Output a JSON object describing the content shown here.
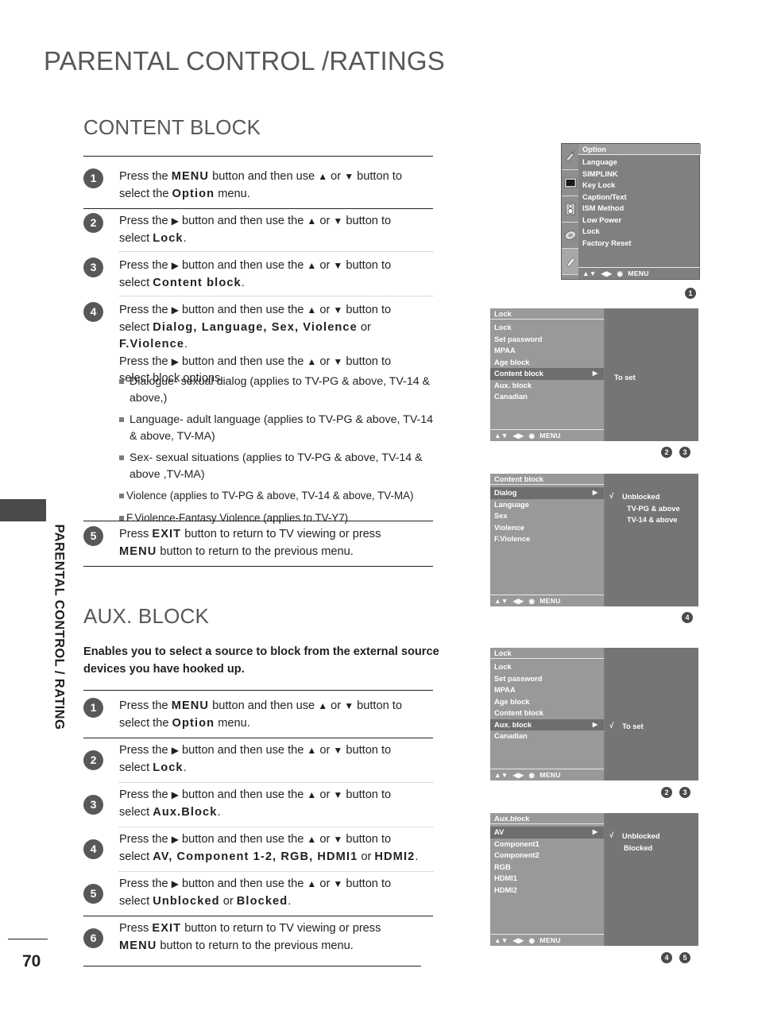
{
  "document": {
    "title": "PARENTAL CONTROL /RATINGS",
    "page_number": "70",
    "side_tab_label": "PARENTAL CONTROL / RATING"
  },
  "content_block": {
    "heading": "CONTENT BLOCK",
    "steps": [
      {
        "num": "1",
        "line1_a": "Press the ",
        "line1_key": "MENU",
        "line1_b": " button and then use ",
        "line1_up": "▲",
        "line1_c": " or ",
        "line1_down": "▼",
        "line1_d": " button to",
        "line2_a": "select the ",
        "line2_key": "Option",
        "line2_b": " menu."
      },
      {
        "num": "2",
        "line1_a": "Press the ",
        "line1_key": "▶",
        "line1_b": " button and then use the ",
        "line1_up": "▲",
        "line1_c": " or ",
        "line1_down": "▼",
        "line1_d": " button to",
        "line2_a": "select ",
        "line2_key": "Lock",
        "line2_b": "."
      },
      {
        "num": "3",
        "line1_a": "Press the ",
        "line1_key": "▶",
        "line1_b": " button and then use the ",
        "line1_up": "▲",
        "line1_c": " or ",
        "line1_down": "▼",
        "line1_d": " button to",
        "line2_a": "select  ",
        "line2_key": "Content block",
        "line2_b": "."
      },
      {
        "num": "4",
        "line1_a": "Press the ",
        "line1_key": "▶",
        "line1_b": " button and then use the ",
        "line1_up": "▲",
        "line1_c": " or ",
        "line1_down": "▼",
        "line1_d": " button to",
        "line2_a": "select ",
        "line2_keys": "Dialog, Language, Sex, Violence",
        "line2_mid": " or ",
        "line2_key2": "F.Violence",
        "line2_b": ".",
        "line3_a": "Press the ",
        "line3_key": "▶",
        "line3_b": " button and then use the ",
        "line3_up": "▲",
        "line3_c": " or ",
        "line3_down": "▼",
        "line3_d": " button to",
        "line4": "select block options."
      },
      {
        "num": "5",
        "line1_a": "Press ",
        "line1_key": "EXIT",
        "line1_b": " button to return to TV viewing or press",
        "line2_key": "MENU",
        "line2_b": " button to return to the previous menu."
      }
    ],
    "bullets": [
      "Dialogue- sexual dialog (applies to TV-PG & above, TV-14 & above,)",
      "Language- adult language (applies to TV-PG & above, TV-14  & above, TV-MA)",
      "Sex- sexual situations (applies to TV-PG  & above, TV-14  & above ,TV-MA)",
      "Violence (applies to TV-PG & above, TV-14 & above, TV-MA)",
      "F.Violence-Fantasy Violence (applies to TV-Y7)"
    ]
  },
  "aux_block": {
    "heading": "AUX. BLOCK",
    "description": "Enables you to select a source to block from the external source devices you have hooked up.",
    "steps": [
      {
        "num": "1",
        "line1_a": "Press the ",
        "line1_key": "MENU",
        "line1_b": " button and then use ",
        "line1_up": "▲",
        "line1_c": " or ",
        "line1_down": "▼",
        "line1_d": " button to",
        "line2_a": "select the ",
        "line2_key": "Option",
        "line2_b": " menu."
      },
      {
        "num": "2",
        "line1_a": "Press the ",
        "line1_key": "▶",
        "line1_b": " button and then use the ",
        "line1_up": "▲",
        "line1_c": " or ",
        "line1_down": "▼",
        "line1_d": " button to",
        "line2_a": "select ",
        "line2_key": "Lock",
        "line2_b": "."
      },
      {
        "num": "3",
        "line1_a": "Press the ",
        "line1_key": "▶",
        "line1_b": " button and then use the ",
        "line1_up": "▲",
        "line1_c": " or ",
        "line1_down": "▼",
        "line1_d": " button to",
        "line2_a": "select ",
        "line2_key": "Aux.Block",
        "line2_b": "."
      },
      {
        "num": "4",
        "line1_a": "Press the ",
        "line1_key": "▶",
        "line1_b": " button and then use the ",
        "line1_up": "▲",
        "line1_c": " or ",
        "line1_down": "▼",
        "line1_d": " button to",
        "line2_a": "select ",
        "line2_keys": "AV, Component 1-2, RGB, HDMI1",
        "line2_mid": " or ",
        "line2_key2": "HDMI2",
        "line2_b": "."
      },
      {
        "num": "5",
        "line1_a": "Press the ",
        "line1_key": "▶",
        "line1_b": " button and then use the ",
        "line1_up": "▲",
        "line1_c": " or ",
        "line1_down": "▼",
        "line1_d": " button to",
        "line2_a": "select ",
        "line2_keys": "Unblocked",
        "line2_mid": " or ",
        "line2_key2": "Blocked",
        "line2_b": "."
      },
      {
        "num": "6",
        "line1_a": "Press ",
        "line1_key": "EXIT",
        "line1_b": " button to return to TV viewing or press",
        "line2_key": "MENU",
        "line2_b": " button to return to the previous menu."
      }
    ]
  },
  "osd": {
    "nav_hint": {
      "updown": "▲▼",
      "leftright": "◀▶",
      "enter": "◉",
      "menu": "MENU"
    },
    "arrow_right": "▶",
    "check": "√",
    "option_menu": {
      "header": "Option",
      "items": [
        "Language",
        "SIMPLINK",
        "Key Lock",
        "Caption/Text",
        "ISM Method",
        "Low Power",
        "Lock",
        "Factory Reset"
      ],
      "rail_icons": [
        "antenna-icon",
        "picture-icon",
        "audio-icon",
        "time-icon",
        "option-icon"
      ],
      "badge": "1"
    },
    "lock_menu_content": {
      "header": "Lock",
      "items": [
        "Lock",
        "Set password",
        "MPAA",
        "Age block",
        "Content block",
        "Aux. block",
        "Canadian"
      ],
      "selected_index": 4,
      "panel_text": "To set",
      "badges": [
        "2",
        "3"
      ]
    },
    "content_block_menu": {
      "header": "Content block",
      "items": [
        "Dialog",
        "Language",
        "Sex",
        "Violence",
        "F.Violence"
      ],
      "selected_index": 0,
      "options": [
        "Unblocked",
        "TV-PG &  above",
        "TV-14 &  above"
      ],
      "checked_index": 0,
      "badge": "4"
    },
    "lock_menu_aux": {
      "header": "Lock",
      "items": [
        "Lock",
        "Set password",
        "MPAA",
        "Age block",
        "Content block",
        "Aux. block",
        "Canadian"
      ],
      "selected_index": 5,
      "panel_text": "To set",
      "badges": [
        "2",
        "3"
      ]
    },
    "aux_block_menu": {
      "header": "Aux.block",
      "items": [
        "AV",
        "Component1",
        "Component2",
        "RGB",
        "HDMI1",
        "HDMI2"
      ],
      "selected_index": 0,
      "options": [
        "Unblocked",
        "Blocked"
      ],
      "checked_index": 0,
      "badges": [
        "4",
        "5"
      ]
    }
  }
}
